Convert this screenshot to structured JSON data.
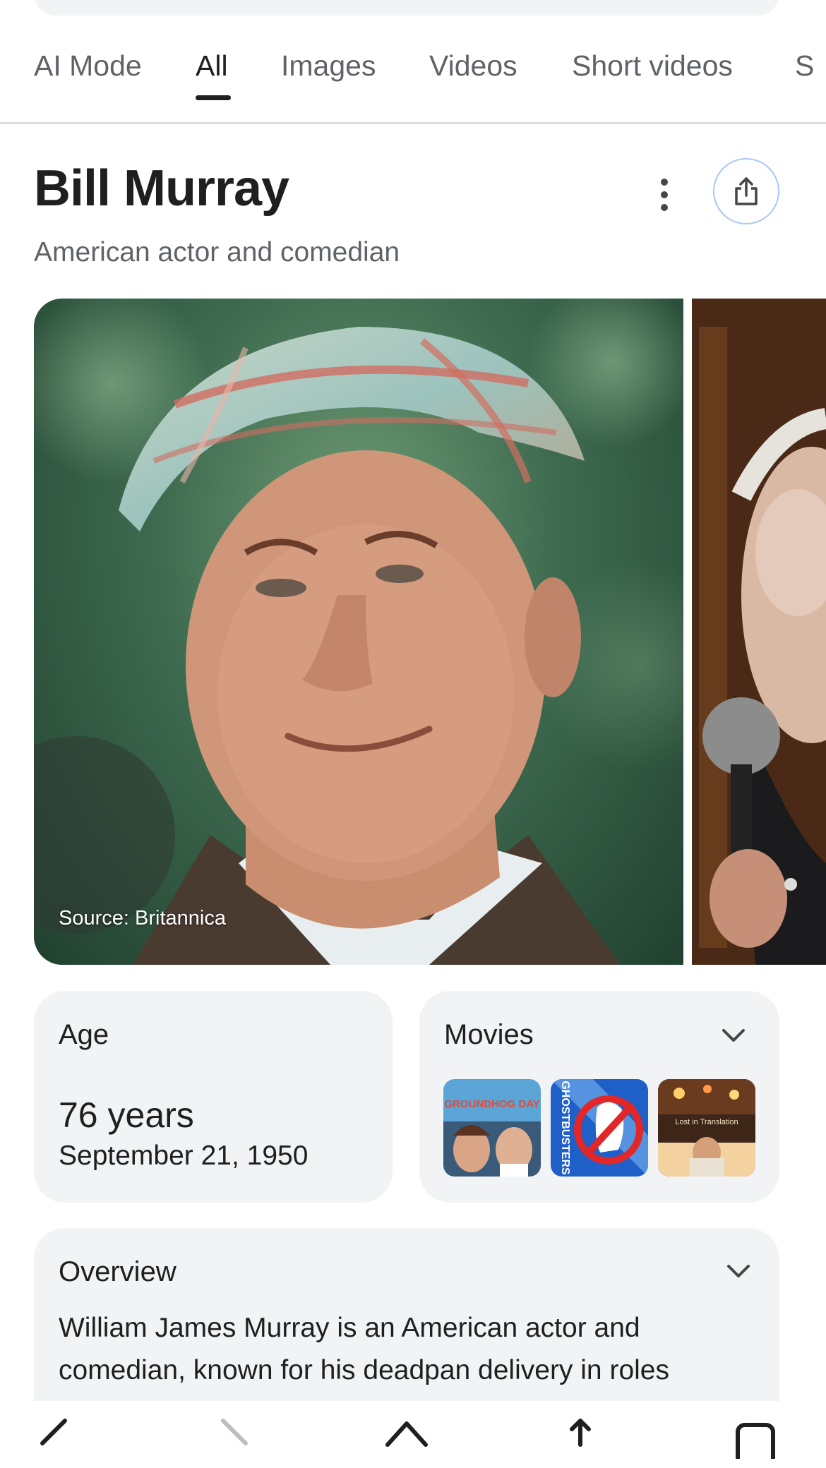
{
  "tabs": [
    {
      "label": "AI Mode"
    },
    {
      "label": "All"
    },
    {
      "label": "Images"
    },
    {
      "label": "Videos"
    },
    {
      "label": "Short videos"
    },
    {
      "label": "S"
    }
  ],
  "entity": {
    "title": "Bill Murray",
    "subtitle": "American actor and comedian"
  },
  "photo": {
    "source": "Source: Britannica"
  },
  "age_card": {
    "label": "Age",
    "years": "76 years",
    "birth_date": "September 21, 1950"
  },
  "movies_card": {
    "label": "Movies",
    "thumbs": [
      {
        "icon": "groundhog-day-poster",
        "text": "GROUNDHOG DAY"
      },
      {
        "icon": "ghostbusters-poster",
        "text": "GHOSTBUSTERS"
      },
      {
        "icon": "lost-in-translation-poster",
        "text": "Lost in Translation"
      }
    ]
  },
  "overview_card": {
    "label": "Overview",
    "text": "William James Murray is an American actor and comedian, known for his deadpan delivery in roles ranging from studio comedies to independent"
  },
  "nav_bar": {
    "icons": [
      "back-icon",
      "forward-icon",
      "home-icon",
      "share-icon",
      "tabs-icon"
    ]
  },
  "colors": {
    "accent_border": "#a8c7fa",
    "card_bg": "#f1f3f4",
    "text_primary": "#1f1f1f",
    "text_secondary": "#5f6368"
  }
}
